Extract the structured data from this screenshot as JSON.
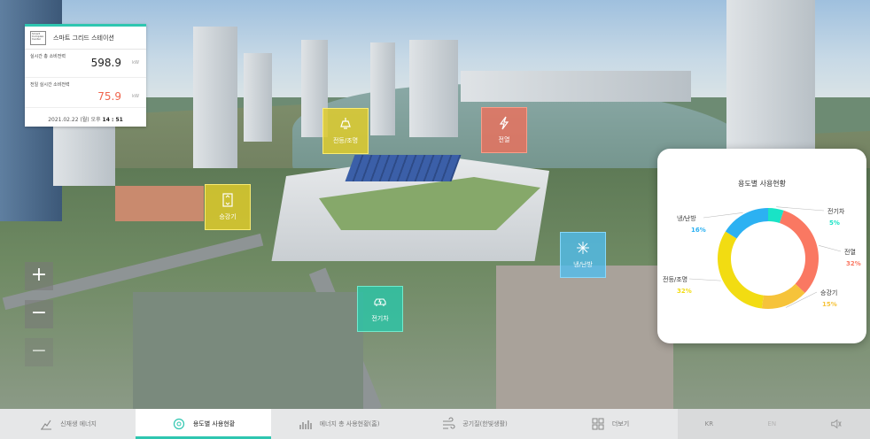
{
  "info_card": {
    "logo_text": "Smart Complex Center",
    "title": "스마트 그리드 스테이션",
    "realtime_label": "실시간 총 소비전력",
    "realtime_value": "598.9",
    "realtime_unit": "kW",
    "prevday_label": "전일 실시간 소비전력",
    "prevday_value": "75.9",
    "prevday_unit": "kW",
    "date_prefix": "2021.02.22 (월) 오후",
    "time": "14 : 51"
  },
  "hotspots": [
    {
      "label": "전등/조명",
      "icon": "ceiling-lamp-icon"
    },
    {
      "label": "전열",
      "icon": "lightning-bolt-icon"
    },
    {
      "label": "승강기",
      "icon": "elevator-icon"
    },
    {
      "label": "냉/난방",
      "icon": "snowflake-sun-icon"
    },
    {
      "label": "전기차",
      "icon": "electric-car-icon"
    }
  ],
  "zoom": {
    "in": "+",
    "out": "−",
    "extra": "−"
  },
  "chart_data": {
    "type": "pie",
    "title": "용도별 사용현황",
    "donut": true,
    "series": [
      {
        "name": "전기차",
        "value": 5,
        "label": "5%",
        "color": "#19e3c6"
      },
      {
        "name": "전열",
        "value": 32,
        "label": "32%",
        "color": "#fa7862"
      },
      {
        "name": "승강기",
        "value": 15,
        "label": "15%",
        "color": "#f6c33a"
      },
      {
        "name": "전등/조명",
        "value": 32,
        "label": "32%",
        "color": "#f2dc12"
      },
      {
        "name": "냉/난방",
        "value": 16,
        "label": "16%",
        "color": "#2cb1f2"
      }
    ]
  },
  "nav": {
    "items": [
      {
        "label": "신재생 에너지",
        "icon": "wind-solar-icon",
        "active": false
      },
      {
        "label": "용도별 사용현황",
        "icon": "usage-cycle-icon",
        "active": true
      },
      {
        "label": "에너지 총 사용현황(홈)",
        "icon": "bar-chart-icon",
        "active": false
      },
      {
        "label": "공기질(한빛생활)",
        "icon": "air-quality-icon",
        "active": false
      },
      {
        "label": "더보기",
        "icon": "grid-icon",
        "active": false
      }
    ],
    "lang_kr": "KR",
    "lang_en": "EN",
    "sound_icon": "speaker-icon"
  },
  "colors": {
    "accent": "#2fc6b0",
    "alert": "#f0654d"
  }
}
